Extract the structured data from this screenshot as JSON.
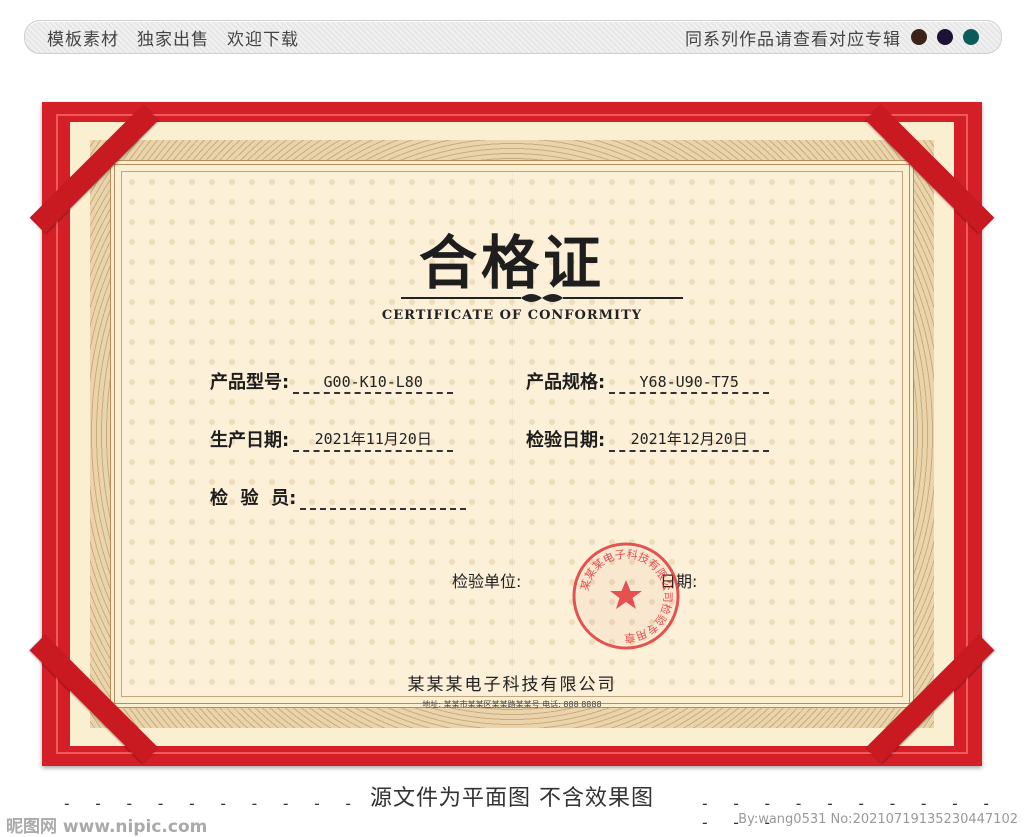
{
  "topbar": {
    "left_items": [
      "模板素材",
      "独家出售",
      "欢迎下载"
    ],
    "right_text": "同系列作品请查看对应专辑",
    "dot_colors": [
      "#3a2418",
      "#1c1336",
      "#0c5b5b"
    ]
  },
  "certificate": {
    "title": "合格证",
    "subtitle": "CERTIFICATE OF CONFORMITY",
    "fields": {
      "model_label": "产品型号:",
      "model_value": "G00-K10-L80",
      "spec_label": "产品规格:",
      "spec_value": "Y68-U90-T75",
      "prod_date_label": "生产日期:",
      "prod_date_value": "2021年11月20日",
      "insp_date_label": "检验日期:",
      "insp_date_value": "2021年12月20日",
      "inspector_label": "检  验  员:",
      "inspector_value": ""
    },
    "unit_label": "检验单位:",
    "date_label": "日期:",
    "seal_text": "某某某电子科技有限公司检验专用章",
    "company": "某某某电子科技有限公司",
    "address": "地址: 某某市某某区某某路某某号     电话: 888 8888",
    "colors": {
      "frame": "#d41f27",
      "paper": "#fbefd2",
      "seal": "#e0363a"
    }
  },
  "footer": {
    "note": "源文件为平面图 不含效果图",
    "dashes": "- - - - - - - - - - - - -",
    "watermark_left": "昵图网 www.nipic.com",
    "watermark_right": "By:wang0531 No:20210719135230447102"
  }
}
